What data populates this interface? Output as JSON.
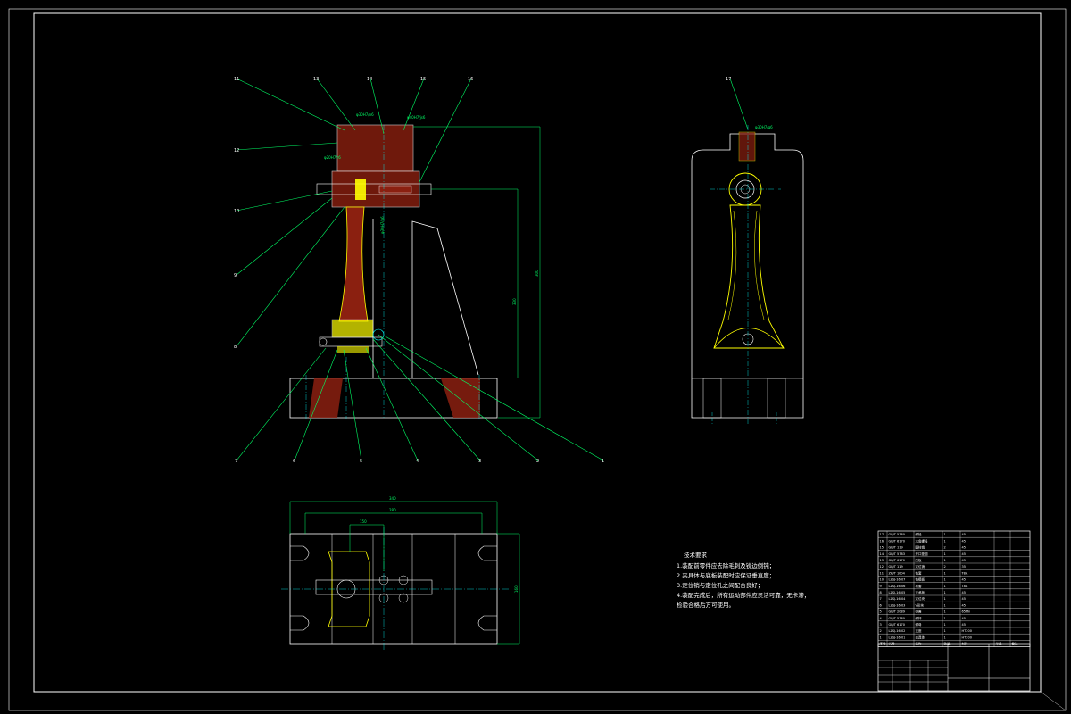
{
  "drawing": {
    "title_block": {
      "name": "",
      "code": "",
      "cells": []
    },
    "tech_requirements": {
      "heading": "技术要求",
      "lines": [
        "1.装配前零件应去除毛刺及锐边倒钝；",
        "2.夹具体与底板装配时应保证垂直度；",
        "3.定位销与定位孔之间配合良好；",
        "4.装配完成后，所有运动部件应灵活可靠，无卡滞；",
        "检验合格后方可使用。"
      ]
    },
    "balloons_front": [
      "11",
      "13",
      "14",
      "15",
      "16",
      "12",
      "10",
      "9",
      "8",
      "7",
      "6",
      "5",
      "4",
      "3",
      "2",
      "1"
    ],
    "balloon_side": "17",
    "dimensions": {
      "front_a": "φ30H7/n6",
      "front_b": "φ40H7/js6",
      "front_c": "φ20H7/r6",
      "front_d": "φ30H7/g6",
      "front_e": "φ20H7/n6",
      "height_1": "300",
      "height_2": "330",
      "side_top": "φ30H7/g6",
      "plan_w1": "340",
      "plan_w2": "280",
      "plan_w3": "150",
      "plan_h": "160"
    },
    "parts_list": [
      [
        "17",
        "GB/T 5780",
        "螺栓",
        "1",
        "45",
        "",
        ""
      ],
      [
        "16",
        "GB/T 6170",
        "六角螺母",
        "1",
        "45",
        "",
        ""
      ],
      [
        "15",
        "GB/T 119",
        "圆柱销",
        "2",
        "45",
        "",
        ""
      ],
      [
        "14",
        "GB/T 5783",
        "开口垫圈",
        "1",
        "45",
        "",
        ""
      ],
      [
        "13",
        "GB/T 6170",
        "压板",
        "1",
        "45",
        "",
        ""
      ],
      [
        "12",
        "GB/T 119",
        "定位销",
        "2",
        "35",
        "",
        ""
      ],
      [
        "11",
        "ZH/T 1004",
        "钻套",
        "1",
        "T8A",
        "",
        ""
      ],
      [
        "10",
        "LZSJ-16-07",
        "钻模板",
        "1",
        "45",
        "",
        ""
      ],
      [
        "9",
        "LZSJ-16-06",
        "衬套",
        "1",
        "T8A",
        "",
        ""
      ],
      [
        "8",
        "LZSJ-16-05",
        "支承板",
        "1",
        "45",
        "",
        ""
      ],
      [
        "7",
        "LZSJ-16-04",
        "定位块",
        "1",
        "45",
        "",
        ""
      ],
      [
        "6",
        "LZSJ-16-03",
        "V形块",
        "1",
        "45",
        "",
        ""
      ],
      [
        "5",
        "GB/T 2089",
        "弹簧",
        "1",
        "65Mn",
        "",
        ""
      ],
      [
        "4",
        "GB/T 5780",
        "螺杆",
        "1",
        "45",
        "",
        ""
      ],
      [
        "3",
        "GB/T 6170",
        "螺母",
        "1",
        "45",
        "",
        ""
      ],
      [
        "2",
        "LZSJ-16-02",
        "支座",
        "1",
        "HT200",
        "",
        ""
      ],
      [
        "1",
        "LZSJ-16-01",
        "夹具体",
        "1",
        "HT200",
        "",
        ""
      ]
    ],
    "parts_header": [
      "序号",
      "代号",
      "名称",
      "数量",
      "材料",
      "单重",
      "备注"
    ]
  }
}
